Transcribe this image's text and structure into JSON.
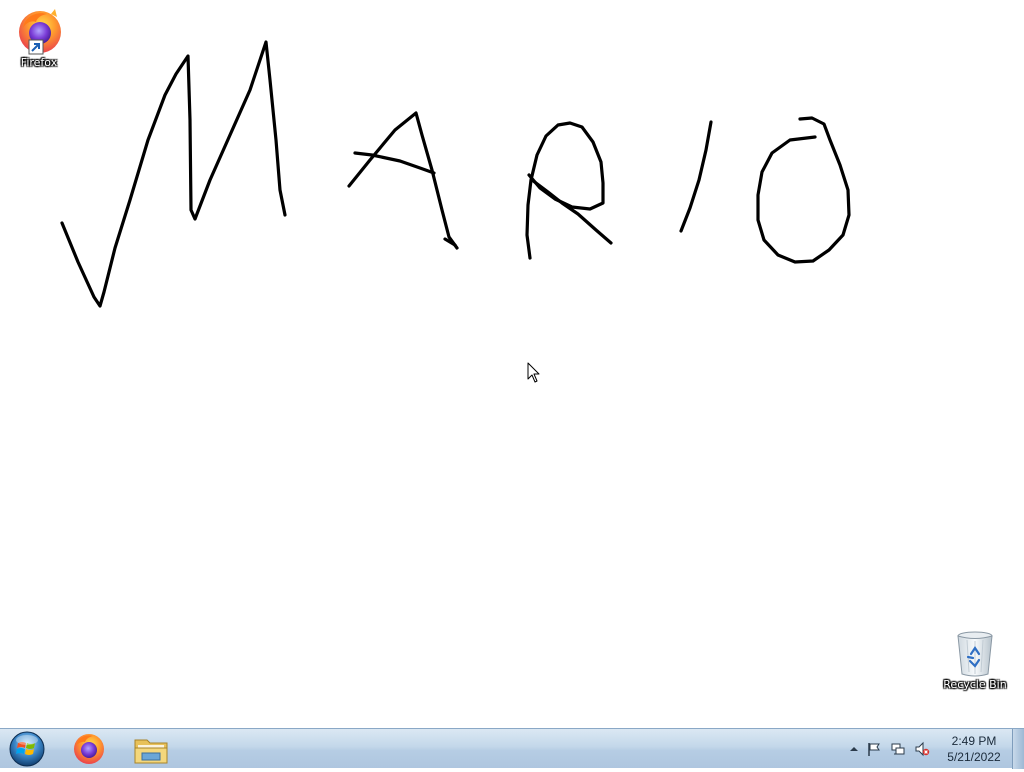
{
  "desktop": {
    "icons": [
      {
        "label": "Firefox",
        "icon": "firefox-icon"
      },
      {
        "label": "Recycle Bin",
        "icon": "recycle-bin-icon"
      }
    ],
    "drawing": {
      "content": "MARIO",
      "stroke_color": "#000000",
      "background_color": "#ffffff"
    }
  },
  "taskbar": {
    "start_icon": "windows-start-icon",
    "pinned": [
      {
        "name": "Firefox",
        "icon": "firefox-icon"
      },
      {
        "name": "Windows Explorer",
        "icon": "folder-icon"
      }
    ],
    "tray": {
      "icons": [
        "show-hidden-icons-arrow",
        "action-center-flag-icon",
        "network-icon",
        "volume-muted-icon"
      ],
      "time": "2:49 PM",
      "date": "5/21/2022"
    }
  }
}
